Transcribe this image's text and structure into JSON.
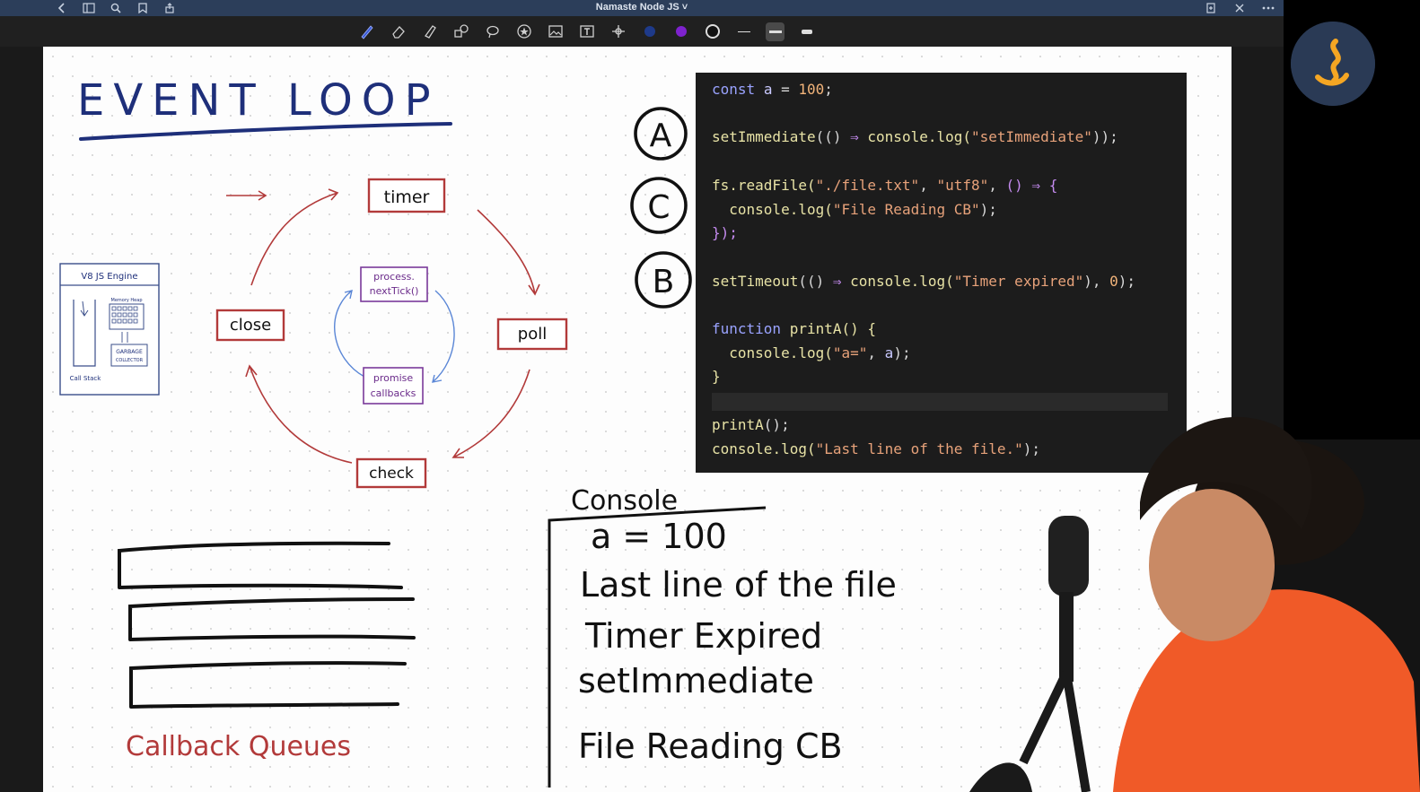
{
  "titlebar": {
    "title": "Namaste Node JS",
    "chevron": "˅"
  },
  "toolbar": {
    "tools": [
      "pen-icon",
      "eraser-icon",
      "highlighter-icon",
      "shapes-icon",
      "lasso-icon",
      "star-icon",
      "image-icon",
      "text-icon",
      "pan-icon"
    ],
    "colors": [
      "#1e3a8a",
      "#7e22ce",
      "#111111"
    ]
  },
  "whiteboard": {
    "heading": "EVENT LOOP",
    "phases": {
      "timer": "timer",
      "poll": "poll",
      "check": "check",
      "close": "close"
    },
    "inner": {
      "next_tick_1": "process.",
      "next_tick_2": "nextTick()",
      "promise_1": "promise",
      "promise_2": "callbacks"
    },
    "engine": {
      "title": "V8 JS Engine",
      "memory_heap": "Memory Heap",
      "gc_1": "GARBAGE",
      "gc_2": "COLLECTOR",
      "call_stack": "Call Stack"
    },
    "callback_queues": "Callback Queues",
    "markers": [
      "A",
      "C",
      "B"
    ],
    "console": {
      "title": "Console",
      "lines": [
        "a = 100",
        "Last line of the file",
        "Timer Expired",
        "setImmediate",
        "File Reading CB"
      ]
    }
  },
  "code": {
    "l1": {
      "kw": "const",
      "name": "a",
      "eq": " = ",
      "num": "100",
      "end": ";"
    },
    "l2": {
      "fn": "setImmediate",
      "p1": "(()",
      "arrow": " ⇒ ",
      "obj": "console",
      "m": ".log(",
      "str": "\"setImmediate\"",
      "end": "));"
    },
    "l3": {
      "obj": "fs",
      "m": ".readFile(",
      "str1": "\"./file.txt\"",
      "c1": ", ",
      "str2": "\"utf8\"",
      "c2": ", ",
      "p": "()",
      "arrow": " ⇒ ",
      "b": "{"
    },
    "l4": {
      "obj": "console",
      "m": ".log(",
      "str": "\"File Reading CB\"",
      "end": ");"
    },
    "l5": {
      "end": "});"
    },
    "l6": {
      "fn": "setTimeout",
      "p1": "(()",
      "arrow": " ⇒ ",
      "obj": "console",
      "m": ".log(",
      "str": "\"Timer expired\"",
      "c": "), ",
      "num": "0",
      "end": ");"
    },
    "l7": {
      "kw": "function",
      "fn": " printA",
      "p": "() {"
    },
    "l8": {
      "obj": "console",
      "m": ".log(",
      "str": "\"a=\"",
      "c": ", ",
      "var": "a",
      "end": ");"
    },
    "l9": {
      "end": "}"
    },
    "l10": {
      "fn": "printA",
      "end": "();"
    },
    "l11": {
      "obj": "console",
      "m": ".log(",
      "str": "\"Last line of the file.\"",
      "end": ");"
    }
  }
}
